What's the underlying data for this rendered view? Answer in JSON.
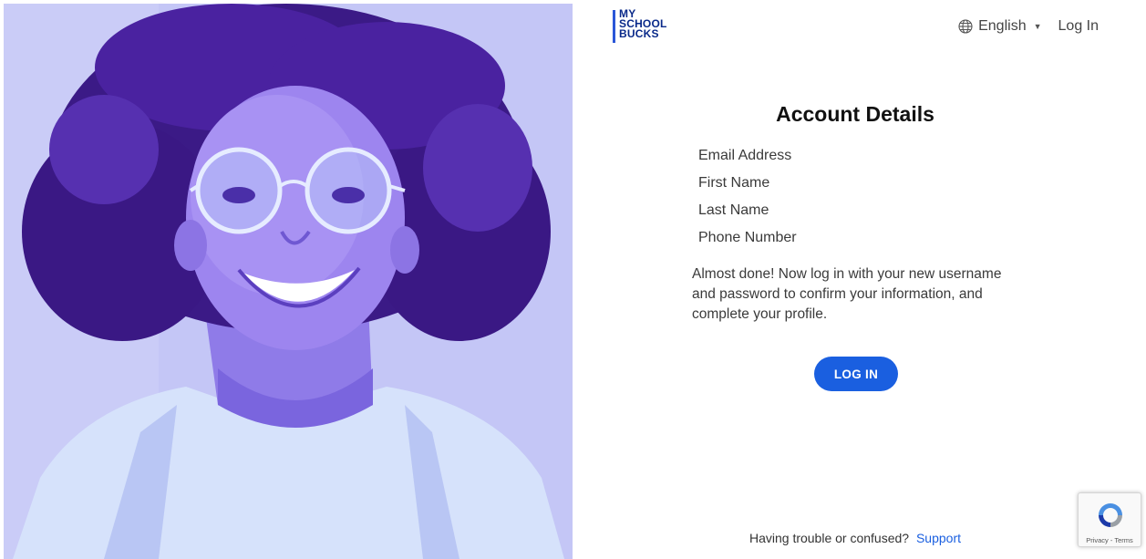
{
  "brand": {
    "logo_lines": [
      "MY",
      "SCHOOL",
      "BUCKS"
    ],
    "accent_color": "#1a5fe0"
  },
  "header": {
    "language": "English",
    "login_link": "Log In"
  },
  "main": {
    "title": "Account Details",
    "fields": [
      "Email Address",
      "First Name",
      "Last Name",
      "Phone Number"
    ],
    "message": "Almost done! Now log in with your new username and password to confirm your information, and complete your profile.",
    "login_button": "LOG IN"
  },
  "footer": {
    "text": "Having trouble or confused?",
    "support_link": "Support"
  },
  "recaptcha": {
    "text": "Privacy - Terms"
  },
  "icons": {
    "globe": "globe-icon",
    "caret": "chevron-down-icon",
    "recaptcha": "recaptcha-icon"
  }
}
